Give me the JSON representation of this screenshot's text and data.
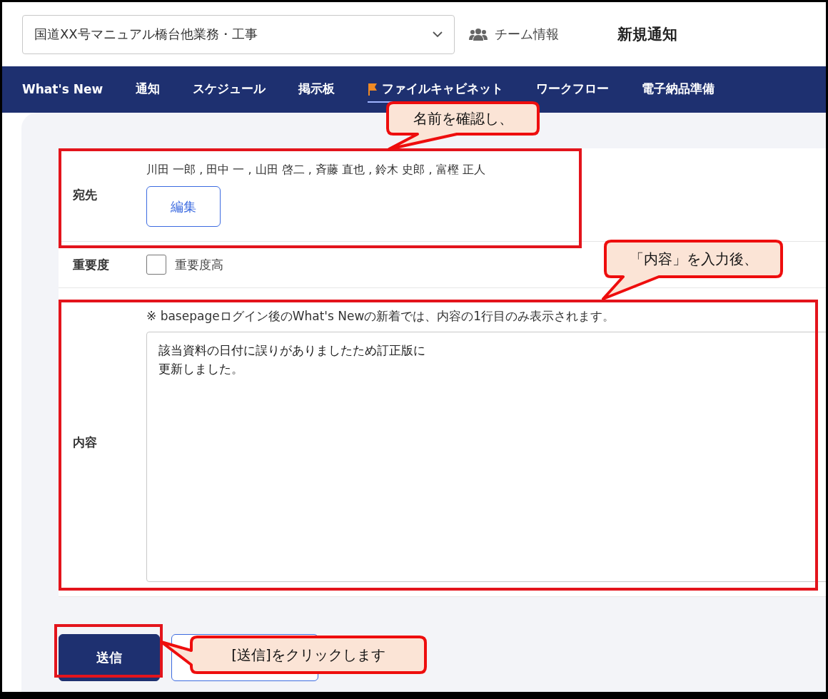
{
  "project_select": {
    "value": "国道XX号マニュアル橋台他業務・工事"
  },
  "team_link": {
    "label": "チーム情報"
  },
  "page_title": "新規通知",
  "nav": [
    {
      "label": "What's New",
      "selected": false
    },
    {
      "label": "通知",
      "selected": false
    },
    {
      "label": "スケジュール",
      "selected": false
    },
    {
      "label": "掲示板",
      "selected": false
    },
    {
      "label": "ファイルキャビネット",
      "selected": true,
      "kind": "flagged"
    },
    {
      "label": "ワークフロー",
      "selected": false
    },
    {
      "label": "電子納品準備",
      "selected": false
    }
  ],
  "form": {
    "recipients": {
      "label": "宛先",
      "names": "川田 一郎 , 田中 一 , 山田 啓二 , 斉藤 直也 , 鈴木 史郎 , 富樫 正人",
      "edit_button": "編集"
    },
    "importance": {
      "label": "重要度",
      "checkbox_label": "重要度高",
      "checked": false
    },
    "content": {
      "label": "内容",
      "note": "※ basepageログイン後のWhat's Newの新着では、内容の1行目のみ表示されます。",
      "value_lines": [
        "該当資料の日付に誤りがありましたため訂正版に",
        "更新しました。"
      ]
    }
  },
  "buttons": [
    {
      "label": "送信",
      "kind": "primary"
    },
    {
      "kind": "secondary"
    }
  ],
  "callouts": [
    {
      "text": "名前を確認し、"
    },
    {
      "text": "「内容」を入力後、"
    },
    {
      "text": "[送信]をクリックします"
    }
  ]
}
